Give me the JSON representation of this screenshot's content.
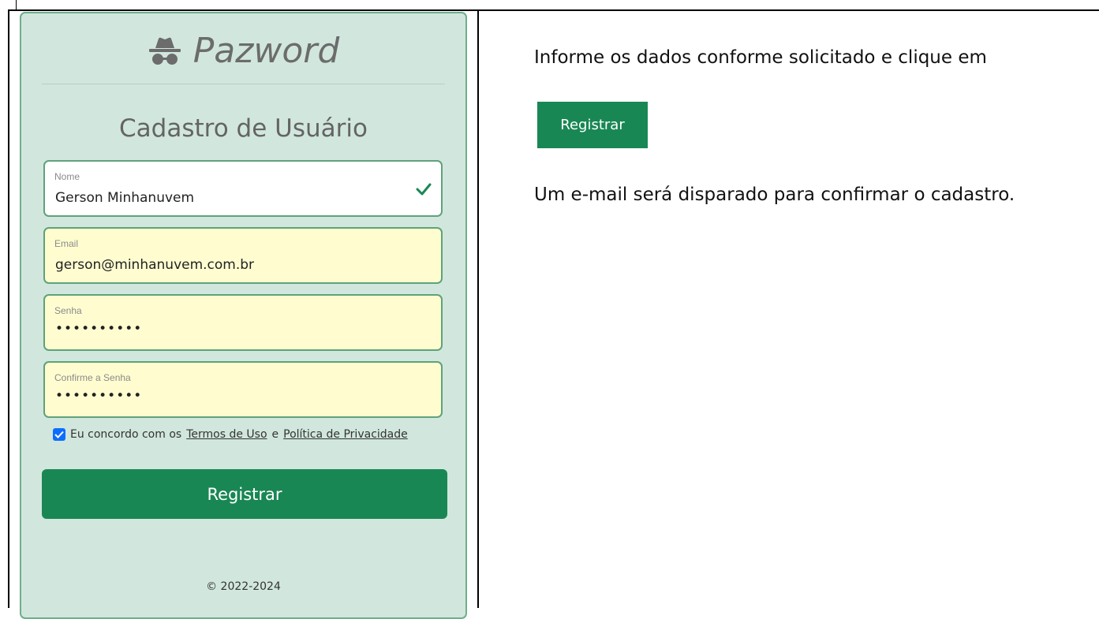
{
  "app": {
    "brand": "Pazword",
    "brand_icon": "incognito-spy-icon",
    "title": "Cadastro de Usuário",
    "fields": {
      "nome": {
        "label": "Nome",
        "value": "Gerson Minhanuvem",
        "valid": true
      },
      "email": {
        "label": "Email",
        "value": "gerson@minhanuvem.com.br"
      },
      "senha": {
        "label": "Senha",
        "value": "••••••••••"
      },
      "confirme": {
        "label": "Confirme a Senha",
        "value": "••••••••••"
      }
    },
    "terms": {
      "checked": true,
      "prefix": "Eu concordo com os",
      "terms_link": "Termos de Uso",
      "connector": "e",
      "privacy_link": "Política de Privacidade"
    },
    "register_label": "Registrar",
    "copyright": "© 2022-2024",
    "colors": {
      "panel_bg": "#d1e7dd",
      "panel_border": "#6fae8c",
      "autofill_bg": "#fffdd0",
      "primary_green": "#198754",
      "checkbox_blue": "#0d6efd"
    }
  },
  "instructions": {
    "line1": "Informe os dados conforme solicitado e clique em",
    "button_label": "Registrar",
    "line2": "Um e-mail será disparado para confirmar o cadastro."
  }
}
